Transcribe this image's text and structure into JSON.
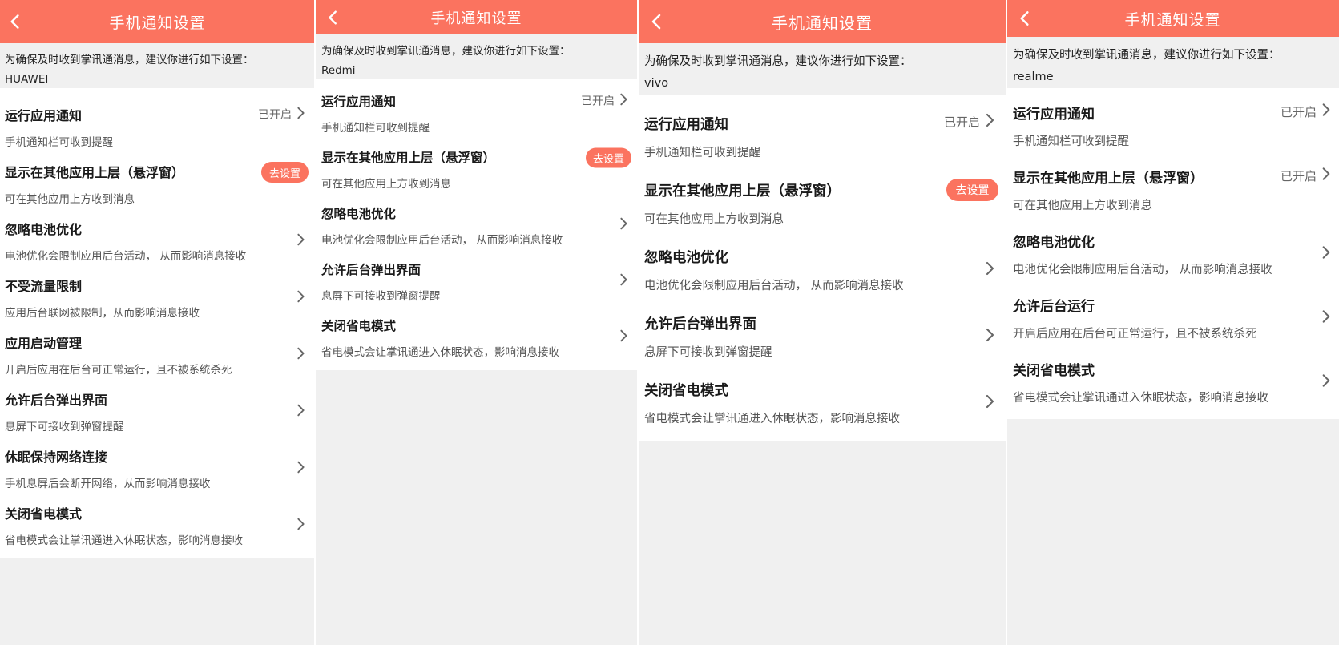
{
  "theme": {
    "accent": "#fb735f",
    "background": "#f0f0f0",
    "card": "#ffffff"
  },
  "icons": {
    "back": "chevron-left-icon",
    "chevron": "chevron-right-icon"
  },
  "panels": [
    {
      "title": "手机通知设置",
      "hint": "为确保及时收到掌讯通消息，建议你进行如下设置：",
      "brand": "HUAWEI",
      "items": [
        {
          "title": "运行应用通知",
          "desc": "手机通知栏可收到提醒",
          "status": "已开启",
          "action": ""
        },
        {
          "title": "显示在其他应用上层（悬浮窗）",
          "desc": "可在其他应用上方收到消息",
          "status": "",
          "action": "去设置"
        },
        {
          "title": "忽略电池优化",
          "desc": "电池优化会限制应用后台活动， 从而影响消息接收",
          "status": "",
          "action": ""
        },
        {
          "title": "不受流量限制",
          "desc": "应用后台联网被限制，从而影响消息接收",
          "status": "",
          "action": ""
        },
        {
          "title": "应用启动管理",
          "desc": "开启后应用在后台可正常运行，且不被系统杀死",
          "status": "",
          "action": ""
        },
        {
          "title": "允许后台弹出界面",
          "desc": "息屏下可接收到弹窗提醒",
          "status": "",
          "action": ""
        },
        {
          "title": "休眠保持网络连接",
          "desc": "手机息屏后会断开网络，从而影响消息接收",
          "status": "",
          "action": ""
        },
        {
          "title": "关闭省电模式",
          "desc": "省电模式会让掌讯通进入休眠状态，影响消息接收",
          "status": "",
          "action": ""
        }
      ]
    },
    {
      "title": "手机通知设置",
      "hint": "为确保及时收到掌讯通消息，建议你进行如下设置：",
      "brand": "Redmi",
      "items": [
        {
          "title": "运行应用通知",
          "desc": "手机通知栏可收到提醒",
          "status": "已开启",
          "action": ""
        },
        {
          "title": "显示在其他应用上层（悬浮窗）",
          "desc": "可在其他应用上方收到消息",
          "status": "",
          "action": "去设置"
        },
        {
          "title": "忽略电池优化",
          "desc": "电池优化会限制应用后台活动， 从而影响消息接收",
          "status": "",
          "action": ""
        },
        {
          "title": "允许后台弹出界面",
          "desc": "息屏下可接收到弹窗提醒",
          "status": "",
          "action": ""
        },
        {
          "title": "关闭省电模式",
          "desc": "省电模式会让掌讯通进入休眠状态，影响消息接收",
          "status": "",
          "action": ""
        }
      ]
    },
    {
      "title": "手机通知设置",
      "hint": "为确保及时收到掌讯通消息，建议你进行如下设置：",
      "brand": "vivo",
      "items": [
        {
          "title": "运行应用通知",
          "desc": "手机通知栏可收到提醒",
          "status": "已开启",
          "action": ""
        },
        {
          "title": "显示在其他应用上层（悬浮窗）",
          "desc": "可在其他应用上方收到消息",
          "status": "",
          "action": "去设置"
        },
        {
          "title": "忽略电池优化",
          "desc": "电池优化会限制应用后台活动， 从而影响消息接收",
          "status": "",
          "action": ""
        },
        {
          "title": "允许后台弹出界面",
          "desc": "息屏下可接收到弹窗提醒",
          "status": "",
          "action": ""
        },
        {
          "title": "关闭省电模式",
          "desc": "省电模式会让掌讯通进入休眠状态，影响消息接收",
          "status": "",
          "action": ""
        }
      ]
    },
    {
      "title": "手机通知设置",
      "hint": "为确保及时收到掌讯通消息，建议你进行如下设置：",
      "brand": "realme",
      "items": [
        {
          "title": "运行应用通知",
          "desc": "手机通知栏可收到提醒",
          "status": "已开启",
          "action": ""
        },
        {
          "title": "显示在其他应用上层（悬浮窗）",
          "desc": "可在其他应用上方收到消息",
          "status": "已开启",
          "action": ""
        },
        {
          "title": "忽略电池优化",
          "desc": "电池优化会限制应用后台活动， 从而影响消息接收",
          "status": "",
          "action": ""
        },
        {
          "title": "允许后台运行",
          "desc": "开启后应用在后台可正常运行，且不被系统杀死",
          "status": "",
          "action": ""
        },
        {
          "title": "关闭省电模式",
          "desc": "省电模式会让掌讯通进入休眠状态，影响消息接收",
          "status": "",
          "action": ""
        }
      ]
    }
  ]
}
